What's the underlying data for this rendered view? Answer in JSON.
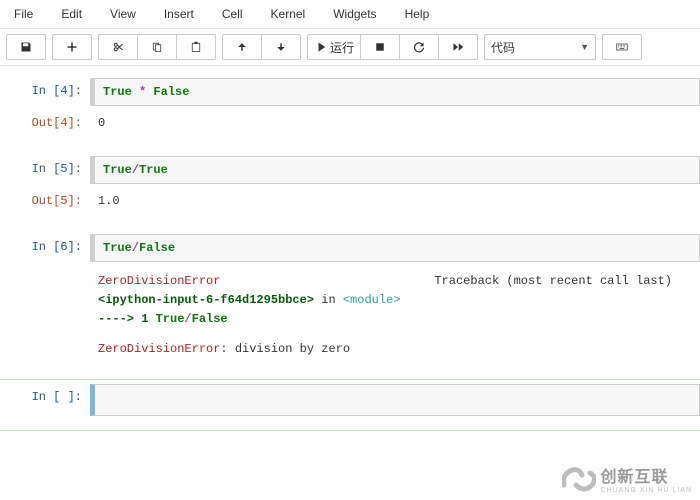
{
  "menubar": {
    "file": "File",
    "edit": "Edit",
    "view": "View",
    "insert": "Insert",
    "cell": "Cell",
    "kernel": "Kernel",
    "widgets": "Widgets",
    "help": "Help"
  },
  "toolbar": {
    "run_label": "运行",
    "cell_type": "代码"
  },
  "cells": [
    {
      "in_prompt": "In  [4]:",
      "code_parts": {
        "a": "True",
        "op": " * ",
        "b": "False"
      },
      "out_prompt": "Out[4]:",
      "out_text": "0"
    },
    {
      "in_prompt": "In  [5]:",
      "code_parts": {
        "a": "True",
        "op": "/",
        "b": "True"
      },
      "out_prompt": "Out[5]:",
      "out_text": "1.0"
    },
    {
      "in_prompt": "In  [6]:",
      "code_parts": {
        "a": "True",
        "op": "/",
        "b": "False"
      },
      "traceback": {
        "err_name1": "ZeroDivisionError",
        "tb_label": "Traceback (most recent call last)",
        "frame_src": "<ipython-input-6-f64d1295bbce>",
        "frame_in": " in ",
        "frame_mod": "<module>",
        "arrow": "----> 1 ",
        "arrow_code_a": "True",
        "arrow_op": "/",
        "arrow_code_b": "False",
        "err_name2": "ZeroDivisionError",
        "err_msg": ": division by zero"
      }
    },
    {
      "in_prompt": "In  [ ]:",
      "code": ""
    }
  ],
  "watermark": {
    "zh": "创新互联",
    "py": "CHUANG XIN HU LIAN"
  }
}
